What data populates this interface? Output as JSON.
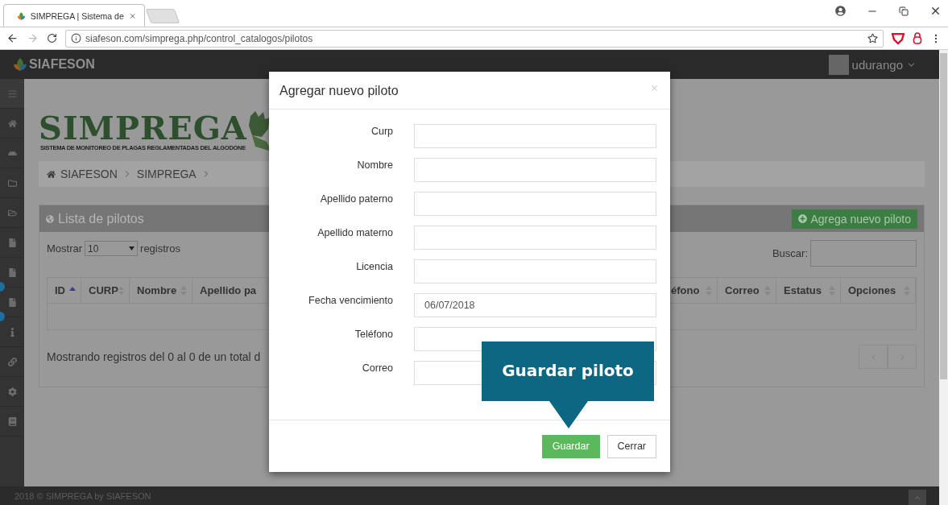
{
  "browser": {
    "tab_title": "SIMPREGA | Sistema de",
    "url": "siafeson.com/simprega.php/control_catalogos/pilotos"
  },
  "topbar": {
    "brand": "SIAFESON",
    "user": "udurango"
  },
  "logo": {
    "title": "SIMPREGA",
    "subtitle": "SISTEMA DE MONITOREO DE PLAGAS REGLAMENTADAS DEL ALGODONE"
  },
  "breadcrumb": [
    "SIAFESON",
    "SIMPREGA"
  ],
  "panel": {
    "title": "Lista de pilotos",
    "add_button": "Agrega nuevo piloto",
    "show_label": "Mostrar",
    "page_size": "10",
    "records_label": "registros",
    "search_label": "Buscar:",
    "columns_left": [
      {
        "label": "ID",
        "sorted": true
      },
      {
        "label": "CURP",
        "sorted": false
      },
      {
        "label": "Nombre",
        "sorted": false
      },
      {
        "label": "Apellido pa"
      }
    ],
    "columns_right": [
      {
        "label": "éfono",
        "sorted": false
      },
      {
        "label": "Correo",
        "sorted": false
      },
      {
        "label": "Estatus",
        "sorted": false
      },
      {
        "label": "Opciones",
        "sorted": false
      }
    ],
    "info": "Mostrando registros del 0 al 0 de un total d"
  },
  "modal": {
    "title": "Agregar nuevo piloto",
    "fields": [
      {
        "label": "Curp"
      },
      {
        "label": "Nombre"
      },
      {
        "label": "Apellido paterno"
      },
      {
        "label": "Apellido materno"
      },
      {
        "label": "Licencia"
      },
      {
        "label": "Fecha vencimiento",
        "value": "06/07/2018"
      },
      {
        "label": "Teléfono"
      },
      {
        "label": "Correo"
      }
    ],
    "buttons": [
      {
        "label": "Guardar",
        "kind": "primary"
      },
      {
        "label": "Cerrar",
        "kind": "default"
      }
    ]
  },
  "callout": {
    "text": "Guardar piloto"
  },
  "footer": {
    "text": "2018 © SIMPREGA by SIAFESON"
  }
}
